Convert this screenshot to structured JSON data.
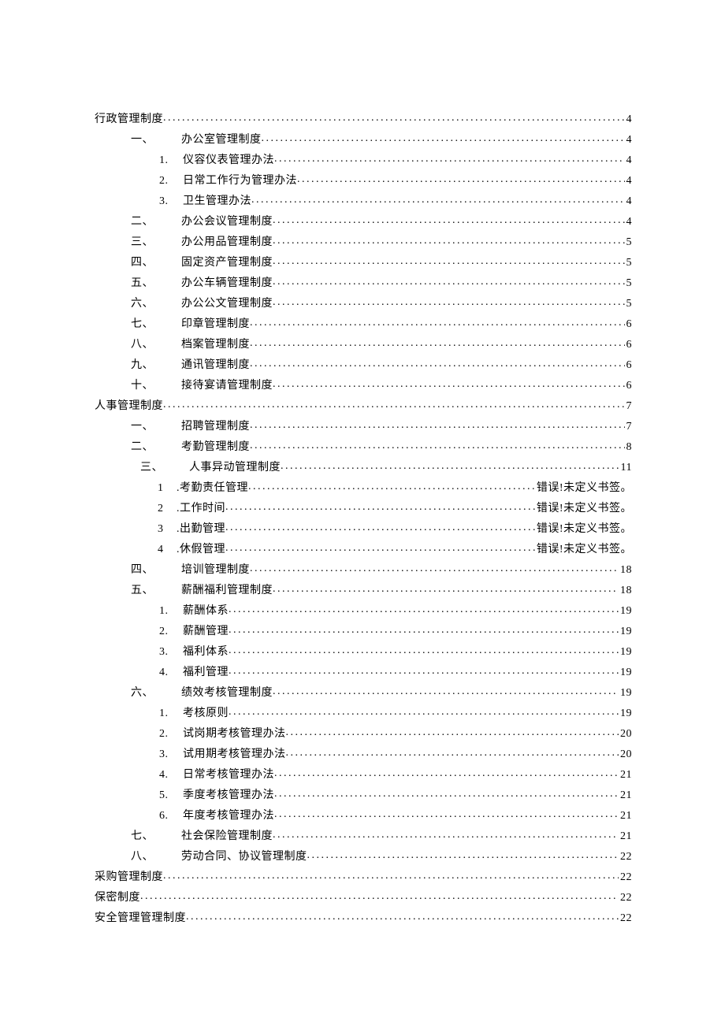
{
  "toc": [
    {
      "level": "indent-0",
      "label": "",
      "text": "行政管理制度",
      "page": "4"
    },
    {
      "level": "indent-1",
      "label": "一、",
      "text": "办公室管理制度",
      "page": "4"
    },
    {
      "level": "indent-2",
      "label": "1.",
      "text": "仪容仪表管理办法",
      "page": "4"
    },
    {
      "level": "indent-2",
      "label": "2.",
      "text": "日常工作行为管理办法",
      "page": "4"
    },
    {
      "level": "indent-2",
      "label": "3.",
      "text": "卫生管理办法",
      "page": "4"
    },
    {
      "level": "indent-1",
      "label": "二、",
      "text": "办公会议管理制度",
      "page": "4"
    },
    {
      "level": "indent-1",
      "label": "三、",
      "text": "办公用品管理制度",
      "page": "5"
    },
    {
      "level": "indent-1",
      "label": "四、",
      "text": "固定资产管理制度",
      "page": "5"
    },
    {
      "level": "indent-1",
      "label": "五、",
      "text": "办公车辆管理制度",
      "page": "5"
    },
    {
      "level": "indent-1",
      "label": "六、",
      "text": "办公公文管理制度",
      "page": "5"
    },
    {
      "level": "indent-1",
      "label": "七、",
      "text": "印章管理制度",
      "page": "6"
    },
    {
      "level": "indent-1",
      "label": "八、",
      "text": "档案管理制度",
      "page": "6"
    },
    {
      "level": "indent-1",
      "label": "九、",
      "text": "通讯管理制度",
      "page": "6"
    },
    {
      "level": "indent-1",
      "label": "十、",
      "text": "接待宴请管理制度",
      "page": "6"
    },
    {
      "level": "indent-0",
      "label": "",
      "text": "人事管理制度",
      "page": "7"
    },
    {
      "level": "indent-1",
      "label": "一、",
      "text": "招聘管理制度",
      "page": "7"
    },
    {
      "level": "indent-1",
      "label": "二、",
      "text": "考勤管理制度",
      "page": "8"
    },
    {
      "level": "indent-hr3",
      "label": "三、",
      "text": "人事异动管理制度",
      "page": "11"
    },
    {
      "level": "indent-2b",
      "label": "1",
      "text": ".考勤责任管理",
      "page": "错误!未定义书签。"
    },
    {
      "level": "indent-2b",
      "label": "2",
      "text": ".工作时间",
      "page": "错误!未定义书签。"
    },
    {
      "level": "indent-2b",
      "label": "3",
      "text": ".出勤管理",
      "page": "错误!未定义书签。"
    },
    {
      "level": "indent-2b",
      "label": "4",
      "text": ".休假管理",
      "page": "错误!未定义书签。"
    },
    {
      "level": "indent-1",
      "label": "四、",
      "text": "培训管理制度",
      "page": "18"
    },
    {
      "level": "indent-1",
      "label": "五、",
      "text": "薪酬福利管理制度",
      "page": "18"
    },
    {
      "level": "indent-2",
      "label": "1.",
      "text": "薪酬体系",
      "page": "19"
    },
    {
      "level": "indent-2",
      "label": "2.",
      "text": "薪酬管理",
      "page": "19"
    },
    {
      "level": "indent-2",
      "label": "3.",
      "text": "福利体系",
      "page": "19"
    },
    {
      "level": "indent-2",
      "label": "4.",
      "text": "福利管理",
      "page": "19"
    },
    {
      "level": "indent-1",
      "label": "六、",
      "text": "绩效考核管理制度",
      "page": "19"
    },
    {
      "level": "indent-2",
      "label": "1.",
      "text": "考核原则",
      "page": "19"
    },
    {
      "level": "indent-2",
      "label": "2.",
      "text": "试岗期考核管理办法",
      "page": "20"
    },
    {
      "level": "indent-2",
      "label": "3.",
      "text": "试用期考核管理办法",
      "page": "20"
    },
    {
      "level": "indent-2",
      "label": "4.",
      "text": "日常考核管理办法",
      "page": "21"
    },
    {
      "level": "indent-2",
      "label": "5.",
      "text": "季度考核管理办法",
      "page": "21"
    },
    {
      "level": "indent-2",
      "label": "6.",
      "text": "年度考核管理办法",
      "page": "21"
    },
    {
      "level": "indent-1",
      "label": "七、",
      "text": "社会保险管理制度",
      "page": "21"
    },
    {
      "level": "indent-1",
      "label": "八、",
      "text": "劳动合同、协议管理制度",
      "page": "22"
    },
    {
      "level": "indent-0",
      "label": "",
      "text": "采购管理制度",
      "page": "22"
    },
    {
      "level": "indent-0",
      "label": "",
      "text": "保密制度",
      "page": "22"
    },
    {
      "level": "indent-0",
      "label": "",
      "text": "安全管理管理制度",
      "page": "22"
    }
  ]
}
